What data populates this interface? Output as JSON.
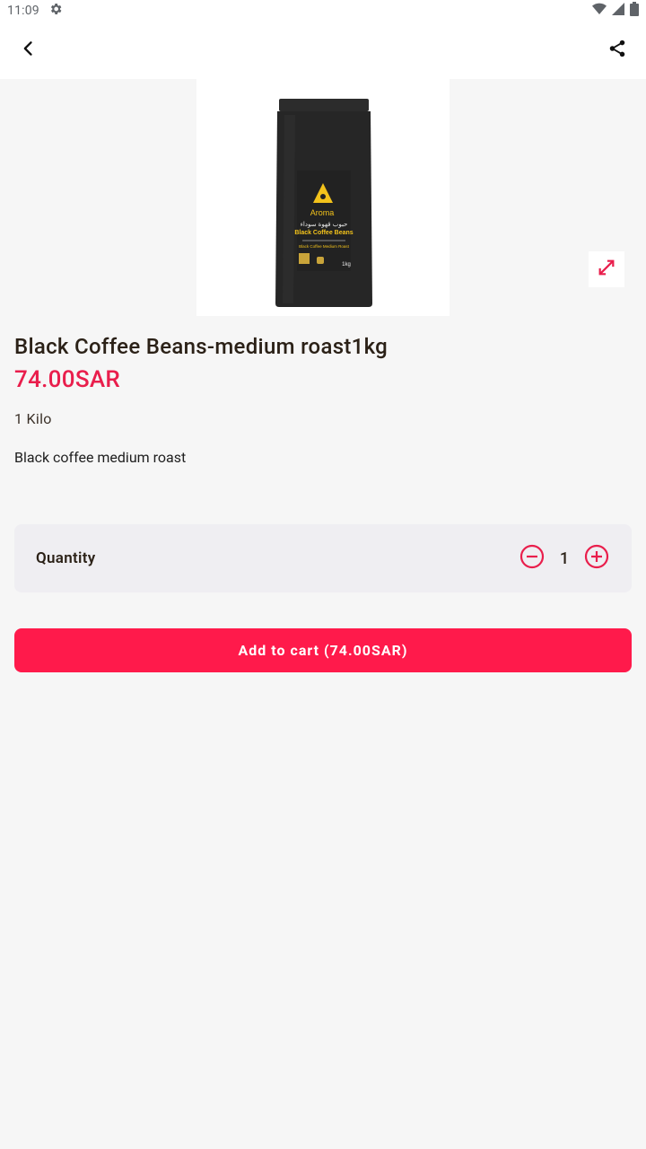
{
  "status_bar": {
    "time": "11:09"
  },
  "app_bar": {
    "back_icon": "chevron-left-icon",
    "share_icon": "share-icon"
  },
  "product": {
    "image_alt": "Black Coffee Beans bag",
    "package": {
      "brand": "Aroma",
      "arabic_name": "حبوب قهوة سوداء",
      "english_name": "Black Coffee Beans",
      "subtitle": "Black Coffee Medium Roast",
      "weight": "1kg"
    },
    "title": "Black Coffee Beans-medium roast1kg",
    "price": "74.00SAR",
    "size": "1 Kilo",
    "description": "Black coffee medium roast"
  },
  "quantity": {
    "label": "Quantity",
    "value": "1"
  },
  "cart": {
    "button_label": "Add to cart (74.00SAR)"
  },
  "colors": {
    "accent": "#ff1a4b",
    "price": "#e91e4c",
    "text": "#2b2117",
    "background": "#f6f6f6",
    "card": "#efeef2"
  }
}
